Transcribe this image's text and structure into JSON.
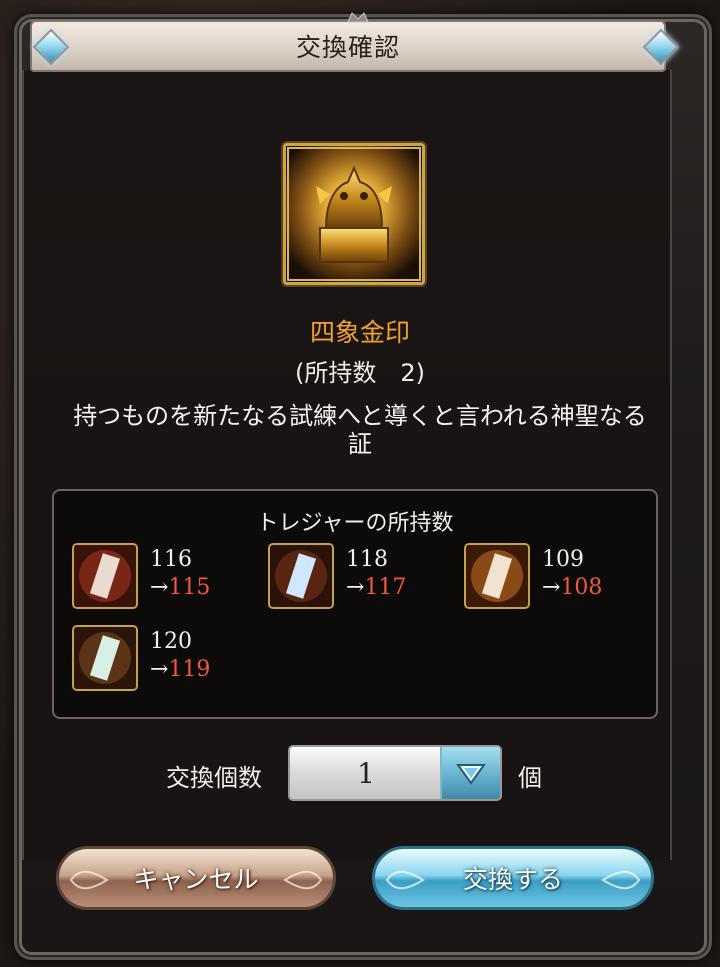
{
  "dialog": {
    "title": "交換確認"
  },
  "item": {
    "name": "四象金印",
    "owned": "(所持数　2)",
    "description": "持つものを新たなる試練へと導くと言われる神聖なる証"
  },
  "treasure": {
    "title": "トレジャーの所持数",
    "items": [
      {
        "count": "116",
        "arrow": "→",
        "after": "115"
      },
      {
        "count": "118",
        "arrow": "→",
        "after": "117"
      },
      {
        "count": "109",
        "arrow": "→",
        "after": "108"
      },
      {
        "count": "120",
        "arrow": "→",
        "after": "119"
      }
    ]
  },
  "quantity": {
    "label": "交換個数",
    "value": "1",
    "unit": "個"
  },
  "buttons": {
    "cancel": "キャンセル",
    "exchange": "交換する"
  },
  "colors": {
    "item_name": "#f3a12a",
    "decrease": "#f05a3a",
    "exchange_button": "#6dc4e3",
    "cancel_button": "#b98d75"
  }
}
